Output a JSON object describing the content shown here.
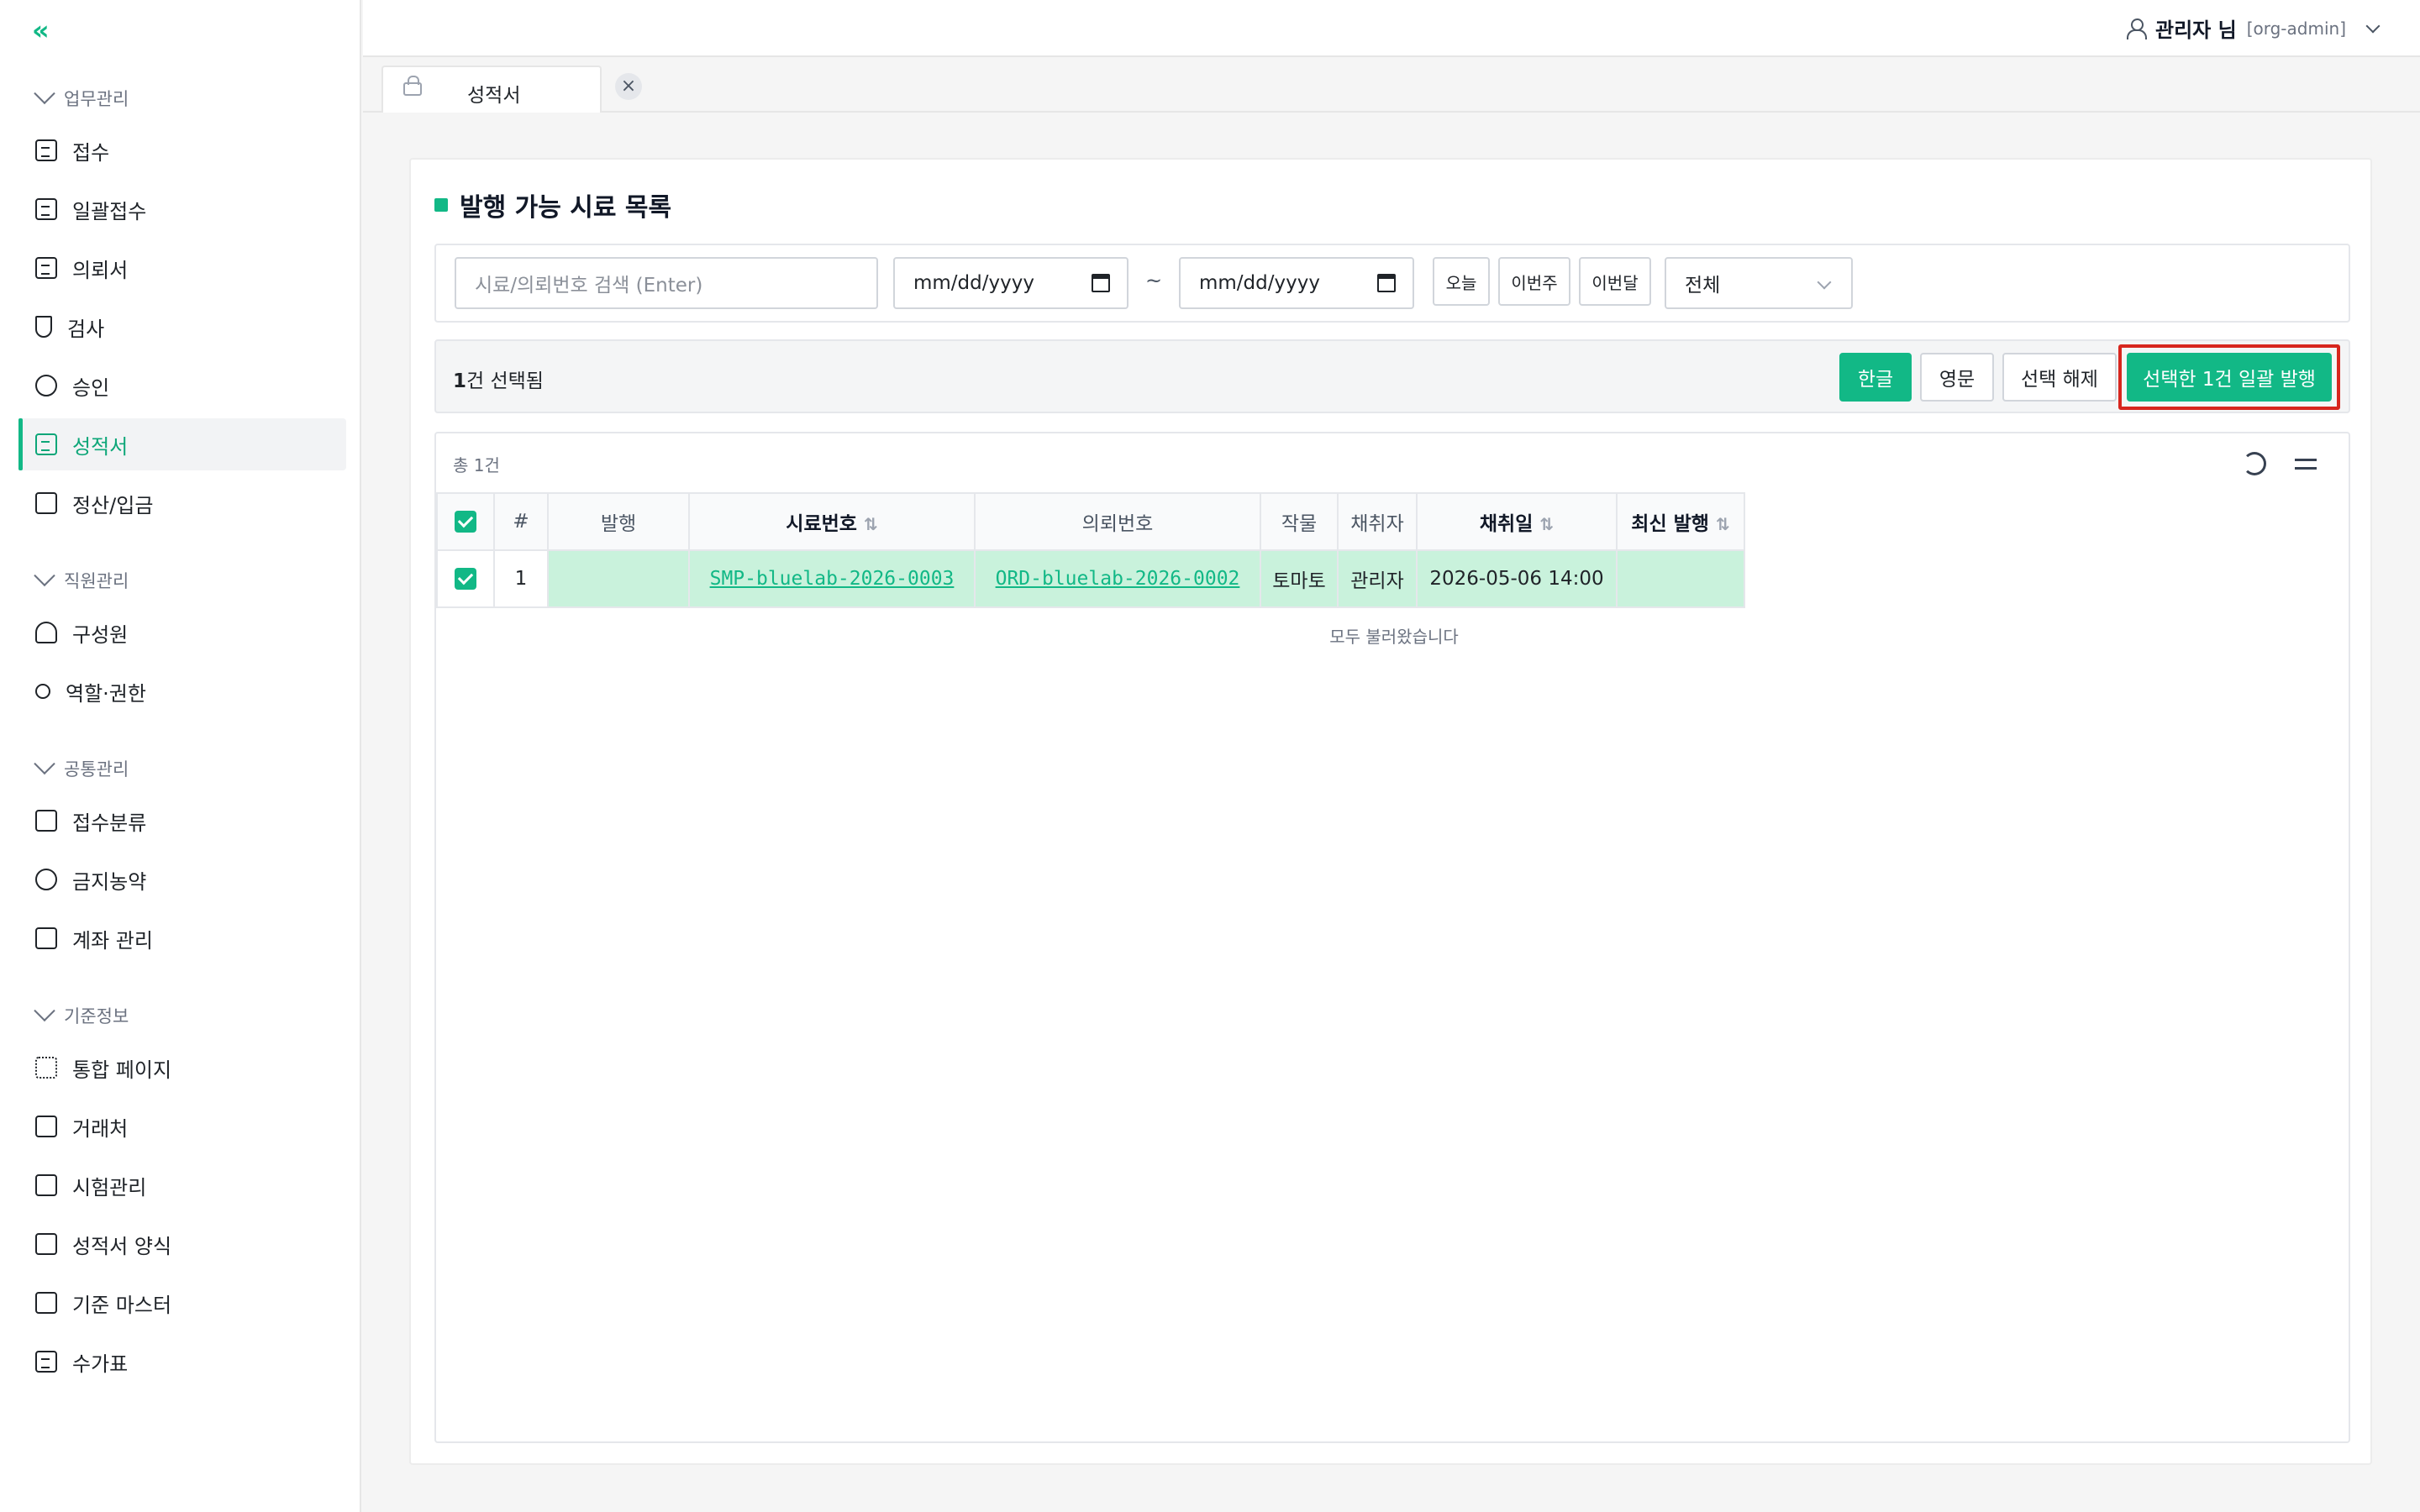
{
  "sidebar": {
    "collapse_icon": "double-chevron-left-icon",
    "sections": [
      {
        "title": "업무관리",
        "items": [
          {
            "label": "접수",
            "icon": "file-plus-icon"
          },
          {
            "label": "일괄접수",
            "icon": "files-plus-icon"
          },
          {
            "label": "의뢰서",
            "icon": "clipboard-icon"
          },
          {
            "label": "검사",
            "icon": "flask-icon"
          },
          {
            "label": "승인",
            "icon": "check-circle-icon"
          },
          {
            "label": "성적서",
            "icon": "document-icon",
            "active": true
          },
          {
            "label": "정산/입금",
            "icon": "wallet-icon"
          }
        ]
      },
      {
        "title": "직원관리",
        "items": [
          {
            "label": "구성원",
            "icon": "users-icon"
          },
          {
            "label": "역할·권한",
            "icon": "key-icon"
          }
        ]
      },
      {
        "title": "공통관리",
        "items": [
          {
            "label": "접수분류",
            "icon": "tags-icon"
          },
          {
            "label": "금지농약",
            "icon": "ban-icon"
          },
          {
            "label": "계좌 관리",
            "icon": "bank-icon"
          }
        ]
      },
      {
        "title": "기준정보",
        "items": [
          {
            "label": "통합 페이지",
            "icon": "grid-icon"
          },
          {
            "label": "거래처",
            "icon": "building-icon"
          },
          {
            "label": "시험관리",
            "icon": "shield-check-icon"
          },
          {
            "label": "성적서 양식",
            "icon": "layout-icon"
          },
          {
            "label": "기준 마스터",
            "icon": "shield-icon"
          },
          {
            "label": "수가표",
            "icon": "price-list-icon"
          }
        ]
      }
    ]
  },
  "header": {
    "user_name": "관리자 님",
    "user_org": "[org-admin]"
  },
  "tabs": [
    {
      "label": "성적서",
      "close": "×"
    }
  ],
  "main": {
    "title": "발행 가능 시료 목록",
    "accent": "#12b886",
    "filters": {
      "search_placeholder": "시료/의뢰번호 검색 (Enter)",
      "date_from": "mm/dd/yyyy",
      "date_to": "mm/dd/yyyy",
      "tilde": "~",
      "quick": [
        "오늘",
        "이번주",
        "이번달"
      ],
      "status_value": "전체"
    },
    "actions": {
      "selected_count": "1",
      "selected_suffix": "건 선택됨",
      "korean": "한글",
      "english": "영문",
      "clear": "선택 해제",
      "bulk_issue": "선택한 1건 일괄 발행"
    },
    "table": {
      "total": "총 1건",
      "sort_glyph": "⇅",
      "columns": [
        "#",
        "발행",
        "시료번호",
        "의뢰번호",
        "작물",
        "채취자",
        "채취일",
        "최신 발행"
      ],
      "rows": [
        {
          "no": "1",
          "issue": "",
          "sample": "SMP-bluelab-2026-0003",
          "order": "ORD-bluelab-2026-0002",
          "crop": "토마토",
          "collector": "관리자",
          "date": "2026-05-06 14:00",
          "latest": ""
        }
      ],
      "footer": "모두 불러왔습니다"
    }
  }
}
